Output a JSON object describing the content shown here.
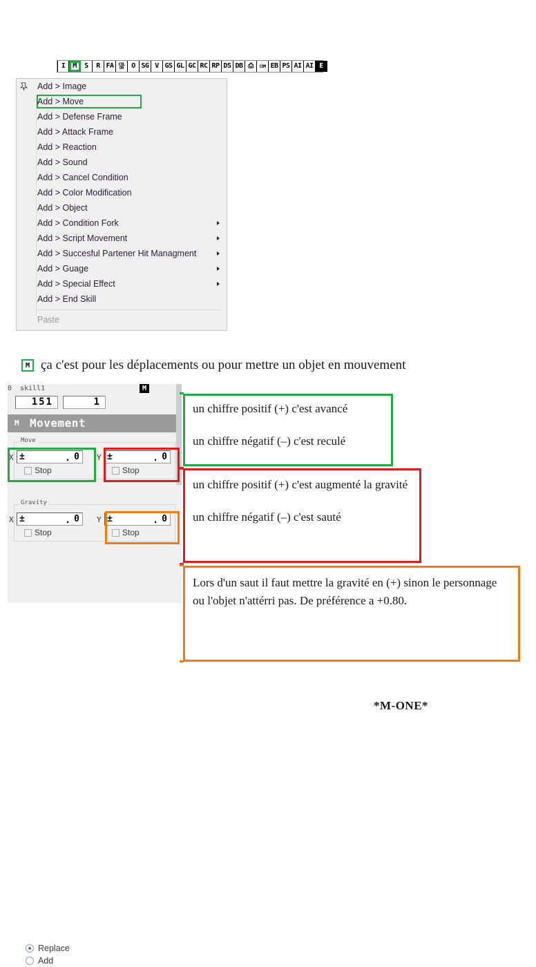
{
  "toolbar": {
    "buttons": [
      {
        "label": "I",
        "style": "normal",
        "selected": false
      },
      {
        "label": "M",
        "style": "normal",
        "selected": true
      },
      {
        "label": "S",
        "style": "normal",
        "selected": false
      },
      {
        "label": "R",
        "style": "normal",
        "selected": false
      },
      {
        "label": "FA",
        "style": "normal",
        "selected": false
      },
      {
        "label": "COL\nOR",
        "style": "tiny",
        "selected": false
      },
      {
        "label": "O",
        "style": "normal",
        "selected": false
      },
      {
        "label": "SG",
        "style": "normal",
        "selected": false
      },
      {
        "label": "V",
        "style": "normal",
        "selected": false
      },
      {
        "label": "GS",
        "style": "normal",
        "selected": false
      },
      {
        "label": "GL",
        "style": "normal",
        "selected": false
      },
      {
        "label": "GC",
        "style": "normal",
        "selected": false
      },
      {
        "label": "RC",
        "style": "normal",
        "selected": false
      },
      {
        "label": "RP",
        "style": "normal",
        "selected": false
      },
      {
        "label": "DS",
        "style": "normal",
        "selected": false
      },
      {
        "label": "DB",
        "style": "normal",
        "selected": false
      },
      {
        "label": "⎙",
        "style": "normal",
        "selected": false
      },
      {
        "label": "COM",
        "style": "tiny",
        "selected": false
      },
      {
        "label": "EB",
        "style": "normal",
        "selected": false
      },
      {
        "label": "PS",
        "style": "normal",
        "selected": false
      },
      {
        "label": "AI",
        "style": "normal",
        "selected": false
      },
      {
        "label": "AI",
        "style": "normal",
        "selected": false
      },
      {
        "label": "E",
        "style": "inverted",
        "selected": false
      }
    ]
  },
  "context_menu": {
    "items": [
      {
        "label": "Add > Image",
        "submenu": false,
        "highlight": false,
        "disabled": false
      },
      {
        "label": "Add > Move",
        "submenu": false,
        "highlight": true,
        "disabled": false
      },
      {
        "label": "Add > Defense Frame",
        "submenu": false,
        "highlight": false,
        "disabled": false
      },
      {
        "label": "Add > Attack Frame",
        "submenu": false,
        "highlight": false,
        "disabled": false
      },
      {
        "label": "Add > Reaction",
        "submenu": false,
        "highlight": false,
        "disabled": false
      },
      {
        "label": "Add > Sound",
        "submenu": false,
        "highlight": false,
        "disabled": false
      },
      {
        "label": "Add > Cancel Condition",
        "submenu": false,
        "highlight": false,
        "disabled": false
      },
      {
        "label": "Add > Color Modification",
        "submenu": false,
        "highlight": false,
        "disabled": false
      },
      {
        "label": "Add > Object",
        "submenu": false,
        "highlight": false,
        "disabled": false
      },
      {
        "label": "Add > Condition Fork",
        "submenu": true,
        "highlight": false,
        "disabled": false
      },
      {
        "label": "Add > Script Movement",
        "submenu": true,
        "highlight": false,
        "disabled": false
      },
      {
        "label": "Add > Succesful Partener Hit Managment",
        "submenu": true,
        "highlight": false,
        "disabled": false
      },
      {
        "label": "Add > Guage",
        "submenu": true,
        "highlight": false,
        "disabled": false
      },
      {
        "label": "Add > Special Effect",
        "submenu": true,
        "highlight": false,
        "disabled": false
      },
      {
        "label": "Add > End Skill",
        "submenu": false,
        "highlight": false,
        "disabled": false
      }
    ],
    "paste_label": "Paste"
  },
  "caption": {
    "badge": "M",
    "text": "ça c'est pour les déplacements ou pour mettre un objet en mouvement"
  },
  "panel": {
    "index": "0",
    "skill_name": "skill1",
    "mode_chip": "M",
    "field_a": "151",
    "field_b": "1",
    "title_code": "M",
    "title_label": "Movement",
    "move_group_label": "Move",
    "gravity_group_label": "Gravity",
    "move_x": {
      "axis": "X",
      "sign": "±",
      "dot": ".",
      "value": "0",
      "stop_label": "Stop",
      "stop_checked": false
    },
    "move_y": {
      "axis": "Y",
      "sign": "±",
      "dot": ".",
      "value": "0",
      "stop_label": "Stop",
      "stop_checked": false
    },
    "gravity_x": {
      "axis": "X",
      "sign": "±",
      "dot": ".",
      "value": "0",
      "stop_label": "Stop",
      "stop_checked": false
    },
    "gravity_y": {
      "axis": "Y",
      "sign": "±",
      "dot": ".",
      "value": "0",
      "stop_label": "Stop",
      "stop_checked": false
    },
    "radio_replace": "Replace",
    "radio_add": "Add",
    "radio_selected": "Replace"
  },
  "notes": {
    "green": {
      "line1": "un chiffre positif (+) c'est avancé",
      "line2": "un chiffre négatif (–) c'est reculé"
    },
    "red": {
      "line1": "un chiffre positif (+) c'est augmenté la gravité",
      "line2": "un chiffre négatif (–) c'est sauté"
    },
    "orange": {
      "line1": "Lors d'un saut il faut mettre la gravité en (+) sinon le personnage ou l'objet n'attérri pas. De préférence a +0.80."
    }
  },
  "footer": {
    "signature": "*M-ONE*"
  },
  "colors": {
    "green": "#22aa44",
    "red": "#e11b1b",
    "orange": "#f07b12",
    "menu_text": "#2b1b32",
    "title_bar": "#9a9a9a"
  }
}
